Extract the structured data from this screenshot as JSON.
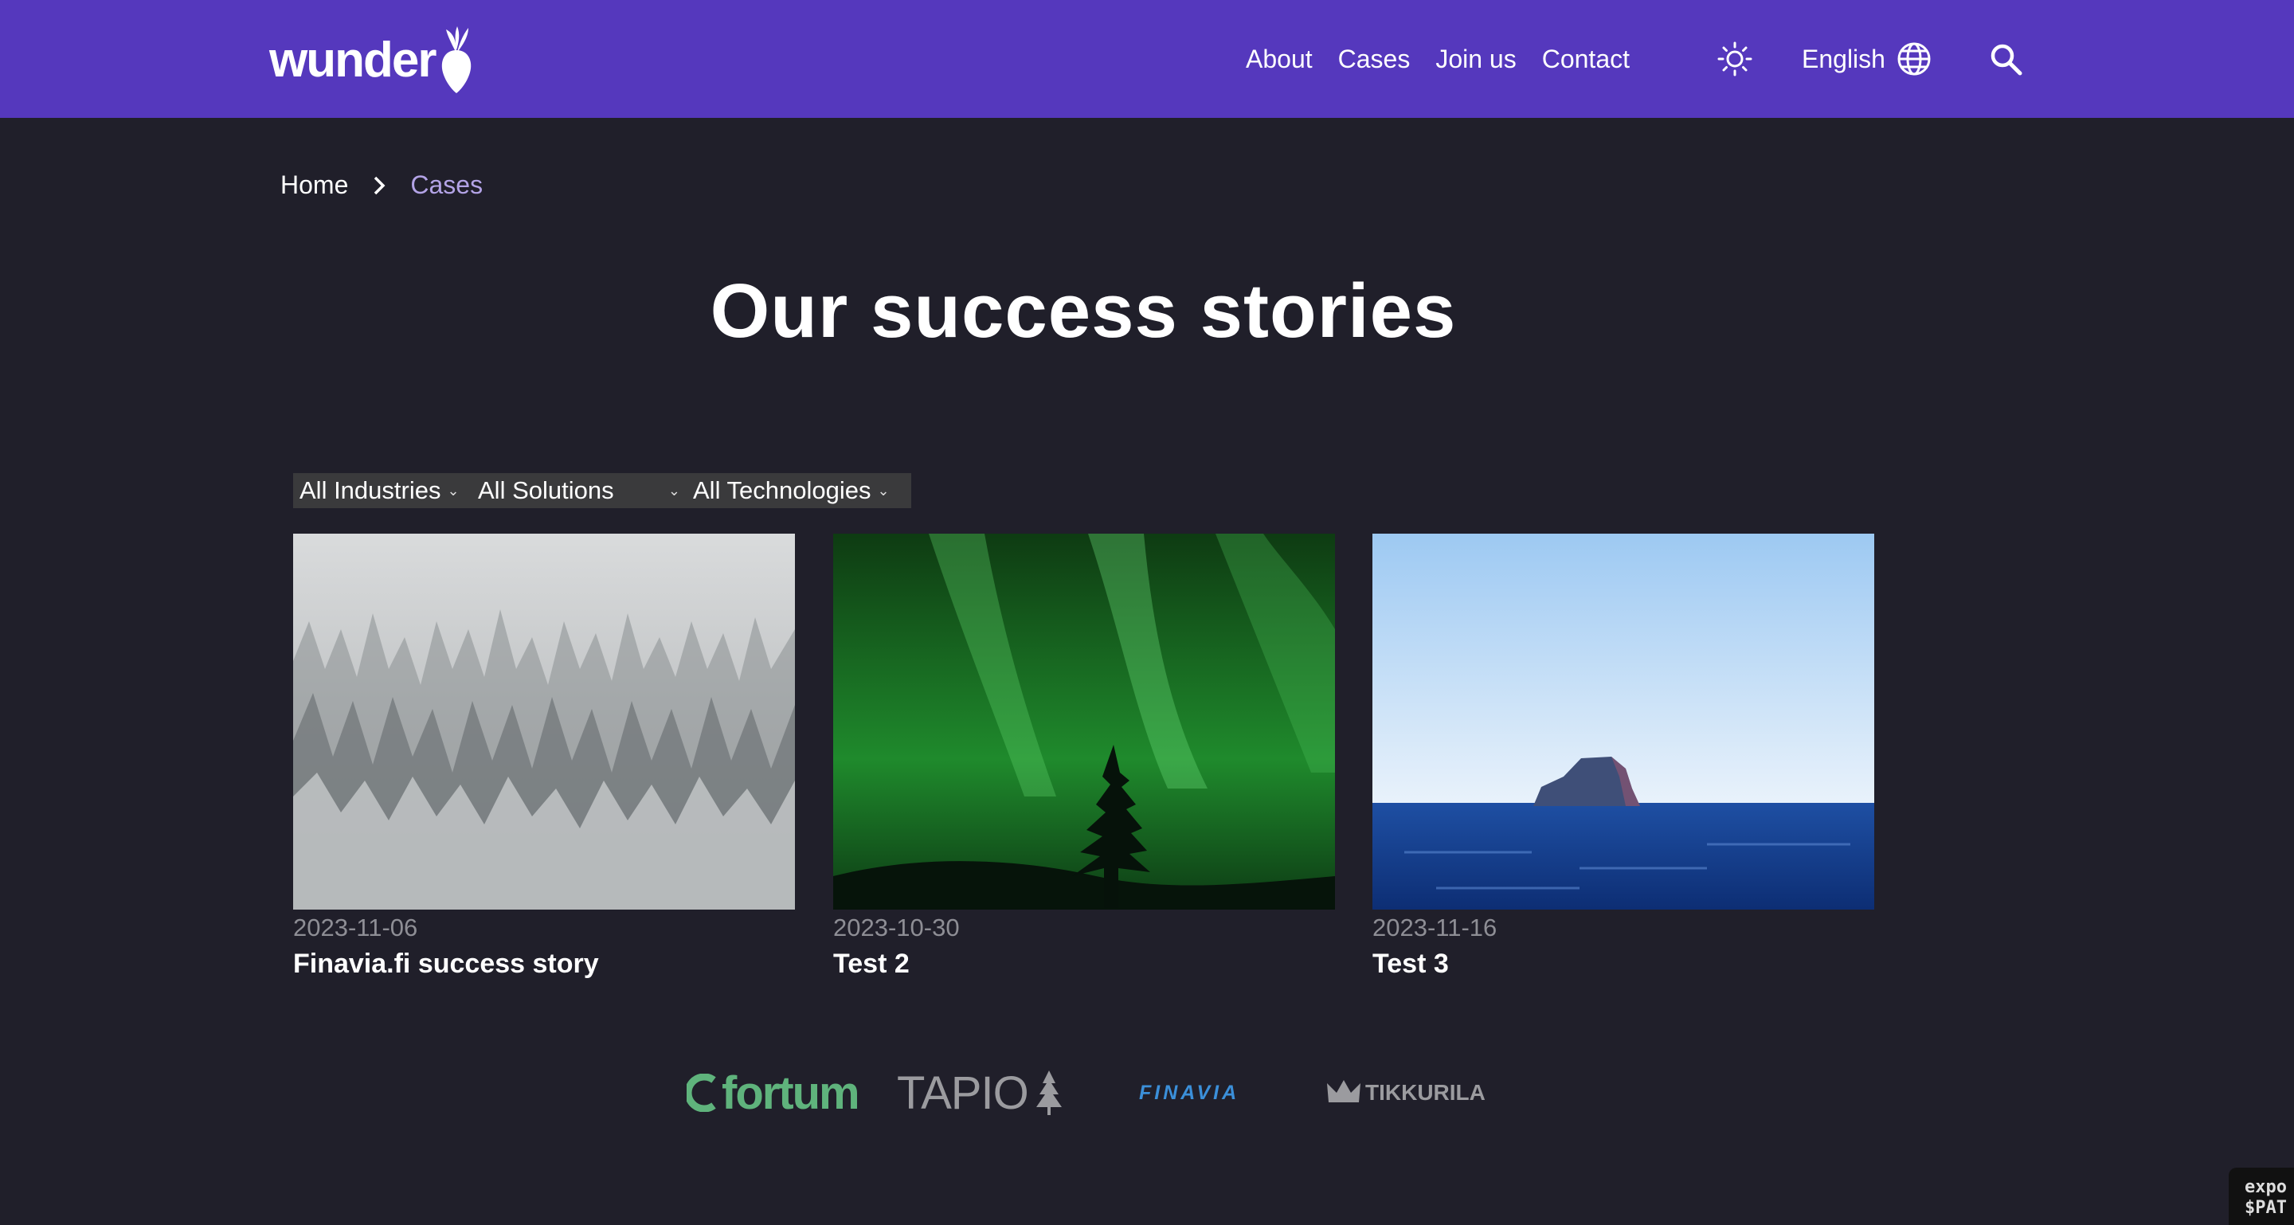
{
  "header": {
    "logo_text": "wunder",
    "nav": [
      "About",
      "Cases",
      "Join us",
      "Contact"
    ],
    "language": "English",
    "bg_color": "#5538bd"
  },
  "breadcrumb": {
    "home": "Home",
    "current": "Cases"
  },
  "page": {
    "title": "Our success stories"
  },
  "filters": {
    "industries": "All Industries",
    "solutions": "All Solutions",
    "technologies": "All Technologies"
  },
  "cases": [
    {
      "date": "2023-11-06",
      "title": "Finavia.fi success story",
      "image": "snowy-forest"
    },
    {
      "date": "2023-10-30",
      "title": "Test 2",
      "image": "northern-lights"
    },
    {
      "date": "2023-11-16",
      "title": "Test 3",
      "image": "island-sea"
    }
  ],
  "clients": {
    "fortum": "fortum",
    "tapio": "TAPIO",
    "finavia": "FINAVIA",
    "tikkurila": "TIKKURILA"
  },
  "corner_badge": [
    "expo",
    "$PAT"
  ]
}
